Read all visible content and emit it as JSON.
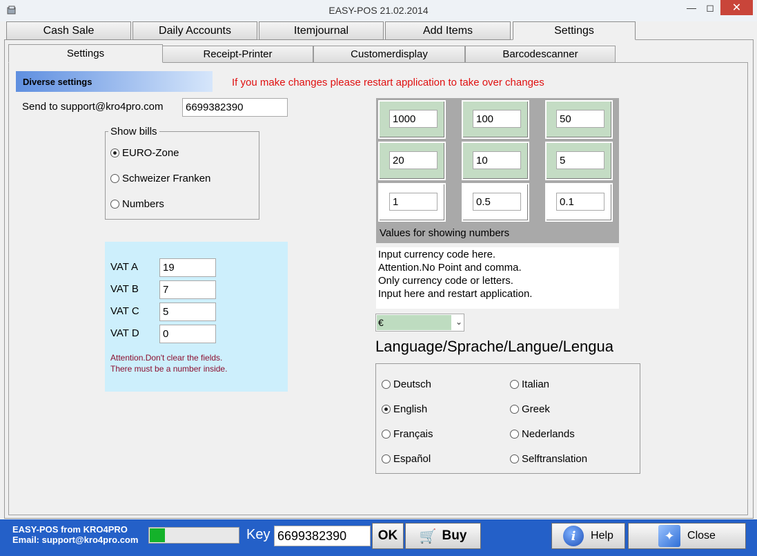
{
  "window": {
    "title": "EASY-POS 21.02.2014"
  },
  "main_tabs": [
    {
      "label": "Cash Sale"
    },
    {
      "label": "Daily Accounts"
    },
    {
      "label": "Itemjournal"
    },
    {
      "label": "Add Items"
    },
    {
      "label": "Settings"
    }
  ],
  "sub_tabs": [
    {
      "label": "Settings"
    },
    {
      "label": "Receipt-Printer"
    },
    {
      "label": "Customerdisplay"
    },
    {
      "label": "Barcodescanner"
    }
  ],
  "settings": {
    "section_title": "Diverse settings",
    "restart_notice": "If you make changes please restart application to take over changes",
    "support_label": "Send to support@kro4pro.com",
    "support_value": "6699382390",
    "show_bills": {
      "title": "Show bills",
      "options": [
        {
          "label": "EURO-Zone",
          "selected": true
        },
        {
          "label": "Schweizer Franken",
          "selected": false
        },
        {
          "label": "Numbers",
          "selected": false
        }
      ]
    },
    "vat": {
      "rows": [
        {
          "label": "VAT A",
          "value": "19"
        },
        {
          "label": "VAT B",
          "value": "7"
        },
        {
          "label": "VAT C",
          "value": "5"
        },
        {
          "label": "VAT D",
          "value": "0"
        }
      ],
      "note_line1": "Attention.Don't clear the fields.",
      "note_line2": "There must be a number inside."
    },
    "number_values": {
      "cells": [
        "1000",
        "100",
        "50",
        "20",
        "10",
        "5",
        "1",
        "0.5",
        "0.1"
      ],
      "caption": "Values for showing numbers",
      "cell_color_green": "#c4dcc4"
    },
    "currency_info": [
      "Input currency code here.",
      "Attention.No Point and comma.",
      "Only currency code or letters.",
      "Input here and restart application."
    ],
    "currency_value": "€",
    "language": {
      "title": "Language/Sprache/Langue/Lengua",
      "options": [
        {
          "label": "Deutsch",
          "selected": false
        },
        {
          "label": "Italian",
          "selected": false
        },
        {
          "label": "English",
          "selected": true
        },
        {
          "label": "Greek",
          "selected": false
        },
        {
          "label": "Français",
          "selected": false
        },
        {
          "label": "Nederlands",
          "selected": false
        },
        {
          "label": "Español",
          "selected": false
        },
        {
          "label": "Selftranslation",
          "selected": false
        }
      ]
    }
  },
  "statusbar": {
    "brand_line1": "EASY-POS from KRO4PRO",
    "brand_line2": "Email: support@kro4pro.com",
    "progress_fraction": 0.17,
    "key_label": "Key",
    "key_value": "6699382390",
    "ok_label": "OK",
    "buy_label": "Buy",
    "help_label": "Help",
    "close_label": "Close",
    "bar_color": "#2460c8",
    "progress_color": "#14b22a"
  }
}
